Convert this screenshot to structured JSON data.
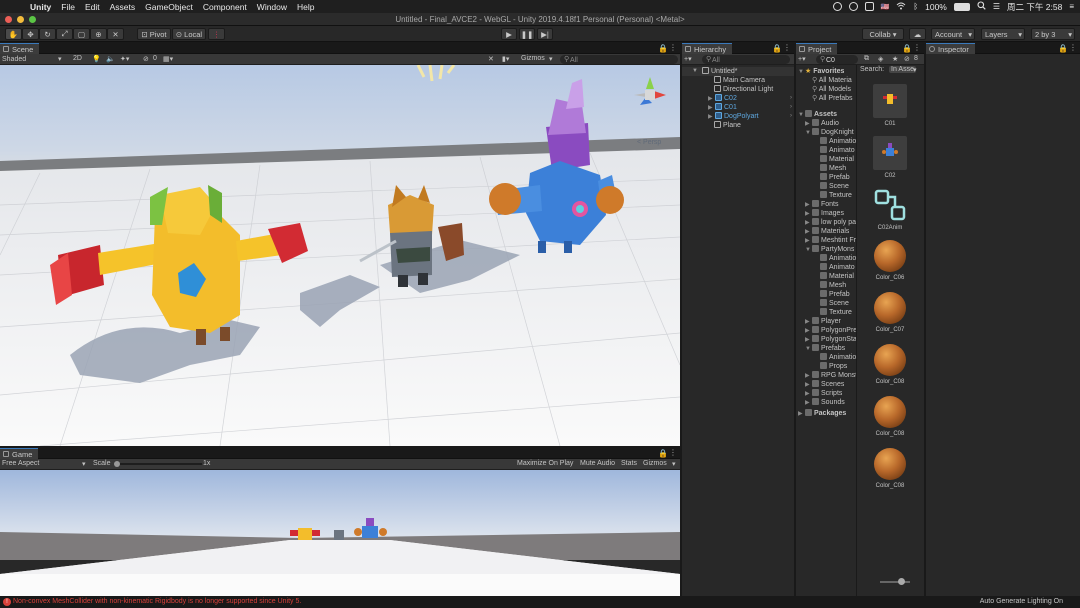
{
  "menubar": {
    "apple": "",
    "items": [
      "Unity",
      "File",
      "Edit",
      "Assets",
      "GameObject",
      "Component",
      "Window",
      "Help"
    ],
    "flag": "🇺🇸",
    "battery": "100%",
    "clock": "周二 下午 2:58"
  },
  "window_title": "Untitled - Final_AVCE2 - WebGL - Unity 2019.4.18f1 Personal (Personal) <Metal>",
  "toolbar": {
    "pivot": "Pivot",
    "local": "Local",
    "collab": "Collab ▾",
    "account": "Account",
    "layers": "Layers",
    "layout": "2 by 3"
  },
  "scene": {
    "tab": "Scene",
    "shading": "Shaded",
    "mode2d": "2D",
    "fx_count": "0",
    "gizmos": "Gizmos",
    "search": "All",
    "persp": "< Persp"
  },
  "game": {
    "tab": "Game",
    "aspect": "Free Aspect",
    "scale_label": "Scale",
    "scale_value": "1x",
    "maximize": "Maximize On Play",
    "mute": "Mute Audio",
    "stats": "Stats",
    "gizmos": "Gizmos"
  },
  "hierarchy": {
    "tab": "Hierarchy",
    "search": "All",
    "scene": "Untitled*",
    "items": [
      {
        "label": "Main Camera",
        "prefab": false
      },
      {
        "label": "Directional Light",
        "prefab": false
      },
      {
        "label": "C02",
        "prefab": true
      },
      {
        "label": "C01",
        "prefab": true
      },
      {
        "label": "DogPolyart",
        "prefab": true
      },
      {
        "label": "Plane",
        "prefab": false
      }
    ]
  },
  "project": {
    "tab": "Project",
    "search": "C0",
    "search_label": "Search:",
    "search_scope": "In Asse",
    "hidden_count": "8",
    "favorites": "Favorites",
    "fav_items": [
      "All Materia",
      "All Models",
      "All Prefabs"
    ],
    "assets_root": "Assets",
    "packages": "Packages",
    "tree": [
      {
        "label": "Audio",
        "depth": 1,
        "open": false
      },
      {
        "label": "DogKnight",
        "depth": 1,
        "open": true
      },
      {
        "label": "Animatio",
        "depth": 2,
        "open": false
      },
      {
        "label": "Animato",
        "depth": 2,
        "open": false
      },
      {
        "label": "Material",
        "depth": 2,
        "open": false
      },
      {
        "label": "Mesh",
        "depth": 2,
        "open": false
      },
      {
        "label": "Prefab",
        "depth": 2,
        "open": false
      },
      {
        "label": "Scene",
        "depth": 2,
        "open": false
      },
      {
        "label": "Texture",
        "depth": 2,
        "open": false
      },
      {
        "label": "Fonts",
        "depth": 1,
        "open": false
      },
      {
        "label": "Images",
        "depth": 1,
        "open": false
      },
      {
        "label": "low poly pa",
        "depth": 1,
        "open": false
      },
      {
        "label": "Materials",
        "depth": 1,
        "open": false
      },
      {
        "label": "Meshtint Fr",
        "depth": 1,
        "open": false
      },
      {
        "label": "PartyMons",
        "depth": 1,
        "open": true
      },
      {
        "label": "Animatio",
        "depth": 2,
        "open": false
      },
      {
        "label": "Animato",
        "depth": 2,
        "open": false
      },
      {
        "label": "Material",
        "depth": 2,
        "open": false
      },
      {
        "label": "Mesh",
        "depth": 2,
        "open": false
      },
      {
        "label": "Prefab",
        "depth": 2,
        "open": false
      },
      {
        "label": "Scene",
        "depth": 2,
        "open": false
      },
      {
        "label": "Texture",
        "depth": 2,
        "open": false
      },
      {
        "label": "Player",
        "depth": 1,
        "open": false
      },
      {
        "label": "PolygonPre",
        "depth": 1,
        "open": false
      },
      {
        "label": "PolygonSta",
        "depth": 1,
        "open": false
      },
      {
        "label": "Prefabs",
        "depth": 1,
        "open": true
      },
      {
        "label": "Animatio",
        "depth": 2,
        "open": false
      },
      {
        "label": "Props",
        "depth": 2,
        "open": false
      },
      {
        "label": "RPG Monst",
        "depth": 1,
        "open": false
      },
      {
        "label": "Scenes",
        "depth": 1,
        "open": false
      },
      {
        "label": "Scripts",
        "depth": 1,
        "open": false
      },
      {
        "label": "Sounds",
        "depth": 1,
        "open": false
      }
    ],
    "assets": [
      {
        "label": "C01",
        "kind": "model"
      },
      {
        "label": "C02",
        "kind": "model"
      },
      {
        "label": "C02Anim",
        "kind": "anim"
      },
      {
        "label": "Color_C06",
        "kind": "material"
      },
      {
        "label": "Color_C07",
        "kind": "material"
      },
      {
        "label": "Color_C08",
        "kind": "material"
      },
      {
        "label": "Color_C08",
        "kind": "material"
      },
      {
        "label": "Color_C08",
        "kind": "material"
      }
    ]
  },
  "inspector": {
    "tab": "Inspector"
  },
  "status": {
    "error": "Non-convex MeshCollider with non-kinematic Rigidbody is no longer supported since Unity 5.",
    "lighting": "Auto Generate Lighting On"
  },
  "colors": {
    "accent": "#3a79bb",
    "error": "#d9413a",
    "prefab": "#5fa8e0"
  }
}
